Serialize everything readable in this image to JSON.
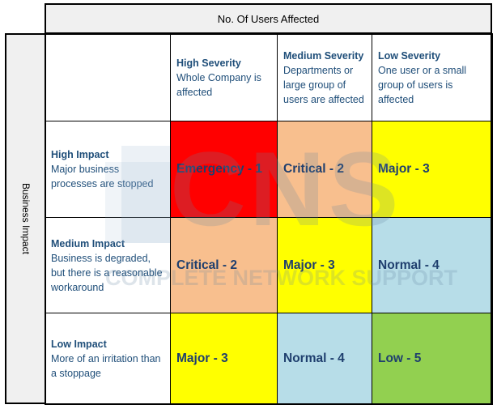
{
  "header": {
    "top": "No. Of Users Affected",
    "side": "Business Impact"
  },
  "columns": [
    {
      "title": "High Severity",
      "desc": "Whole Company is affected"
    },
    {
      "title": "Medium Severity",
      "desc": "Departments or large group of users are affected"
    },
    {
      "title": "Low Severity",
      "desc": "One user or a small group of users is affected"
    }
  ],
  "rows": [
    {
      "title": "High Impact",
      "desc": "Major business processes are stopped",
      "cells": [
        {
          "label": "Emergency - 1",
          "color": "#ff0000"
        },
        {
          "label": "Critical - 2",
          "color": "#f8bf8e"
        },
        {
          "label": "Major - 3",
          "color": "#ffff00"
        }
      ]
    },
    {
      "title": "Medium Impact",
      "desc": "Business is degraded, but there is a reasonable workaround",
      "cells": [
        {
          "label": "Critical - 2",
          "color": "#f8bf8e"
        },
        {
          "label": "Major - 3",
          "color": "#ffff00"
        },
        {
          "label": "Normal - 4",
          "color": "#b7dde8"
        }
      ]
    },
    {
      "title": "Low Impact",
      "desc": "More of an irritation than a stoppage",
      "cells": [
        {
          "label": "Major - 3",
          "color": "#ffff00"
        },
        {
          "label": "Normal - 4",
          "color": "#b7dde8"
        },
        {
          "label": "Low - 5",
          "color": "#92d050"
        }
      ]
    }
  ],
  "watermark": {
    "logo": "CNS",
    "tagline": "COMPLETE NETWORK SUPPORT"
  }
}
